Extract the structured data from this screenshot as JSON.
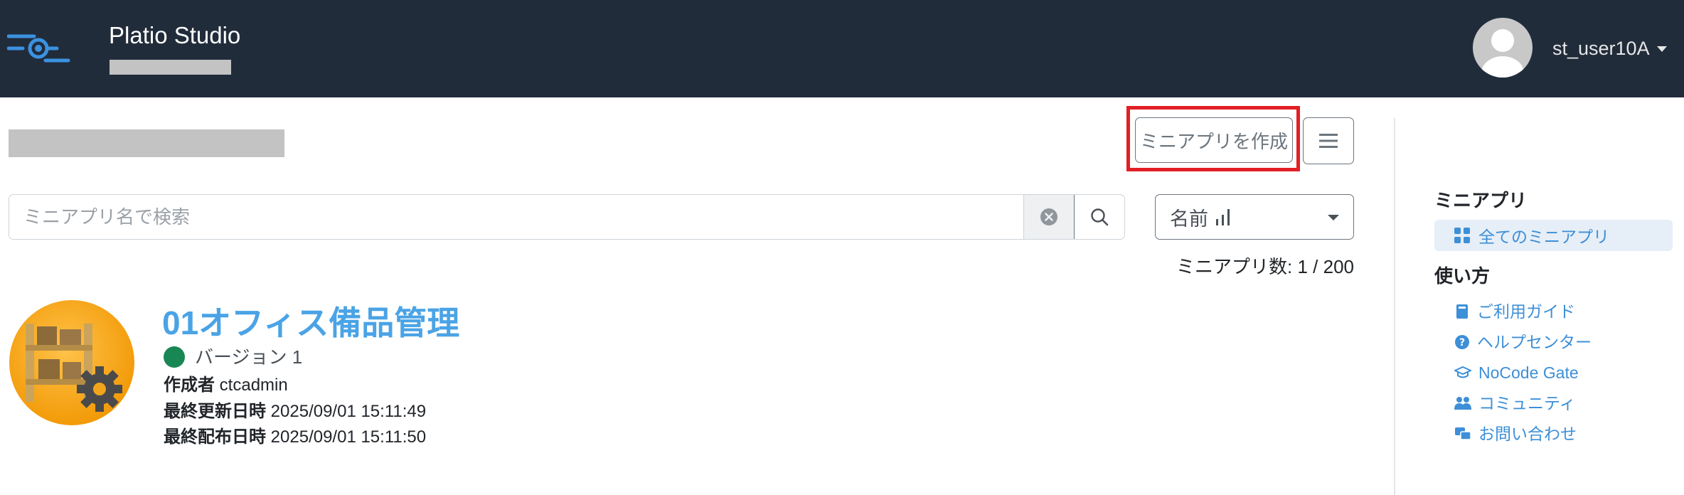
{
  "header": {
    "app_title": "Platio Studio",
    "user_name": "st_user10A"
  },
  "toolbar": {
    "create_label": "ミニアプリを作成"
  },
  "search": {
    "placeholder": "ミニアプリ名で検索",
    "value": ""
  },
  "sort": {
    "selected": "名前"
  },
  "list": {
    "count_text": "ミニアプリ数: 1 / 200",
    "apps": [
      {
        "name": "01オフィス備品管理",
        "version": "バージョン 1",
        "creator_label": "作成者",
        "creator": "ctcadmin",
        "updated_label": "最終更新日時",
        "updated": "2025/09/01 15:11:49",
        "published_label": "最終配布日時",
        "published": "2025/09/01 15:11:50",
        "status_color": "#198754"
      }
    ]
  },
  "sidebar": {
    "section1_title": "ミニアプリ",
    "all_apps": "全てのミニアプリ",
    "section2_title": "使い方",
    "links": [
      {
        "label": "ご利用ガイド",
        "icon": "book-icon"
      },
      {
        "label": "ヘルプセンター",
        "icon": "help-circle-icon"
      },
      {
        "label": "NoCode Gate",
        "icon": "graduation-cap-icon"
      },
      {
        "label": "コミュニティ",
        "icon": "users-icon"
      },
      {
        "label": "お問い合わせ",
        "icon": "chat-icon"
      }
    ]
  },
  "colors": {
    "topbar": "#212c3b",
    "link": "#3d8fd8",
    "highlight": "#e21f26",
    "status_active": "#198754"
  }
}
